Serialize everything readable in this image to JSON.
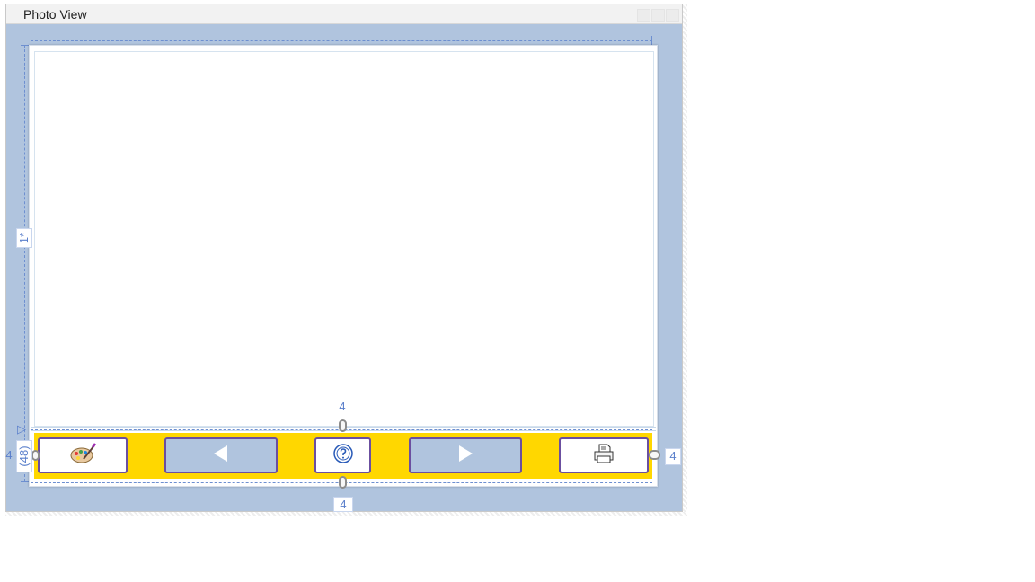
{
  "window": {
    "title": "Photo View"
  },
  "adorners": {
    "row_star": "1*",
    "row_auto": "(48)",
    "margin_left": "4",
    "margin_right": "4",
    "margin_top": "4",
    "margin_bottom": "4"
  },
  "toolbar": {
    "buttons": [
      {
        "name": "edit-button",
        "icon": "paint-palette-icon",
        "style": "white"
      },
      {
        "name": "previous-button",
        "icon": "left-arrow-icon",
        "style": "blue"
      },
      {
        "name": "help-button",
        "icon": "help-icon",
        "style": "white"
      },
      {
        "name": "next-button",
        "icon": "right-arrow-icon",
        "style": "blue"
      },
      {
        "name": "print-button",
        "icon": "printer-icon",
        "style": "white"
      }
    ]
  },
  "colors": {
    "background": "#b0c4de",
    "toolbar": "#ffd700",
    "button_border": "#6b4fa0",
    "adorner": "#5a7fcb"
  }
}
